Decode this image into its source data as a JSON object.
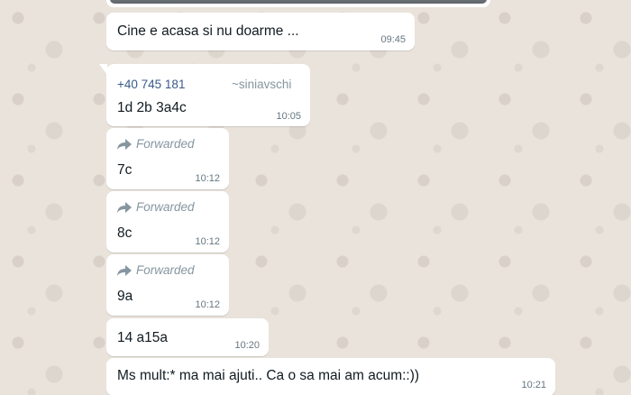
{
  "colors": {
    "wallpaper": "#e9e3dc",
    "bubble_incoming": "#ffffff",
    "sender_phone": "#3b5a8a",
    "meta_text": "#667781"
  },
  "icons": {
    "forward": "forward-arrow-icon"
  },
  "messages": [
    {
      "text": "Cine e acasa si nu doarme ...",
      "time": "09:45"
    },
    {
      "sender_phone": "+40 745 181",
      "sender_name": "~siniavschi",
      "text": "1d 2b 3a4c",
      "time": "10:05"
    },
    {
      "forwarded_label": "Forwarded",
      "text": "7c",
      "time": "10:12"
    },
    {
      "forwarded_label": "Forwarded",
      "text": "8c",
      "time": "10:12"
    },
    {
      "forwarded_label": "Forwarded",
      "text": "9a",
      "time": "10:12"
    },
    {
      "text": "14 a15a",
      "time": "10:20"
    },
    {
      "text": "Ms mult:* ma mai ajuti.. Ca o sa mai am acum::))",
      "time": "10:21"
    }
  ]
}
